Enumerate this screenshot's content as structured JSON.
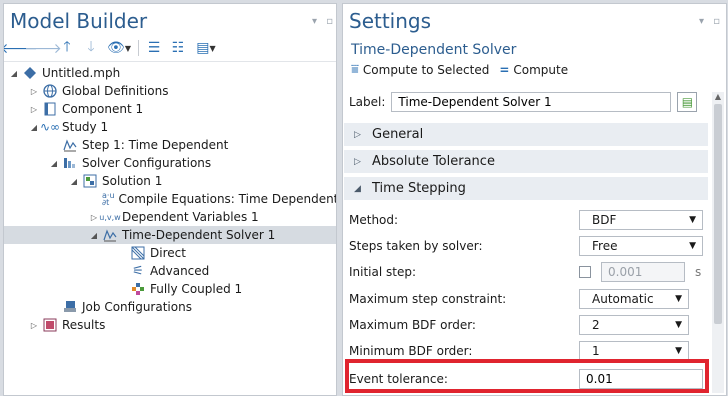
{
  "model_builder": {
    "title": "Model Builder",
    "tree": [
      {
        "label": "Untitled.mph",
        "icon": "model-icon",
        "toggle": "open"
      },
      {
        "label": "Global Definitions",
        "icon": "globe-icon",
        "toggle": "closed"
      },
      {
        "label": "Component 1",
        "icon": "component-icon",
        "toggle": "closed"
      },
      {
        "label": "Study 1",
        "icon": "study-icon",
        "toggle": "open"
      },
      {
        "label": "Step 1: Time Dependent",
        "icon": "time-step-icon",
        "toggle": ""
      },
      {
        "label": "Solver Configurations",
        "icon": "solver-config-icon",
        "toggle": "open"
      },
      {
        "label": "Solution 1",
        "icon": "solution-icon",
        "toggle": "open"
      },
      {
        "label": "Compile Equations: Time Dependent",
        "icon": "compile-icon",
        "toggle": ""
      },
      {
        "label": "Dependent Variables 1",
        "icon": "dependent-vars-icon",
        "toggle": "closed"
      },
      {
        "label": "Time-Dependent Solver 1",
        "icon": "time-solver-icon",
        "toggle": "open"
      },
      {
        "label": "Direct",
        "icon": "direct-icon",
        "toggle": ""
      },
      {
        "label": "Advanced",
        "icon": "advanced-icon",
        "toggle": ""
      },
      {
        "label": "Fully Coupled 1",
        "icon": "fully-coupled-icon",
        "toggle": ""
      },
      {
        "label": "Job Configurations",
        "icon": "job-config-icon",
        "toggle": ""
      },
      {
        "label": "Results",
        "icon": "results-icon",
        "toggle": "closed"
      }
    ]
  },
  "settings": {
    "title": "Settings",
    "subtitle": "Time-Dependent Solver",
    "compute_to_selected": "Compute to Selected",
    "compute": "Compute",
    "label_caption": "Label:",
    "label_value": "Time-Dependent Solver 1",
    "sections": {
      "general": "General",
      "absolute_tolerance": "Absolute Tolerance",
      "time_stepping": "Time Stepping"
    },
    "fields": {
      "method_label": "Method:",
      "method_value": "BDF",
      "steps_label": "Steps taken by solver:",
      "steps_value": "Free",
      "initial_step_label": "Initial step:",
      "initial_step_value": "0.001",
      "initial_step_unit": "s",
      "max_step_label": "Maximum step constraint:",
      "max_step_value": "Automatic",
      "max_bdf_label": "Maximum BDF order:",
      "max_bdf_value": "2",
      "min_bdf_label": "Minimum BDF order:",
      "min_bdf_value": "1",
      "event_tol_label": "Event tolerance:",
      "event_tol_value": "0.01"
    },
    "highlight_color": "#e0242f"
  }
}
